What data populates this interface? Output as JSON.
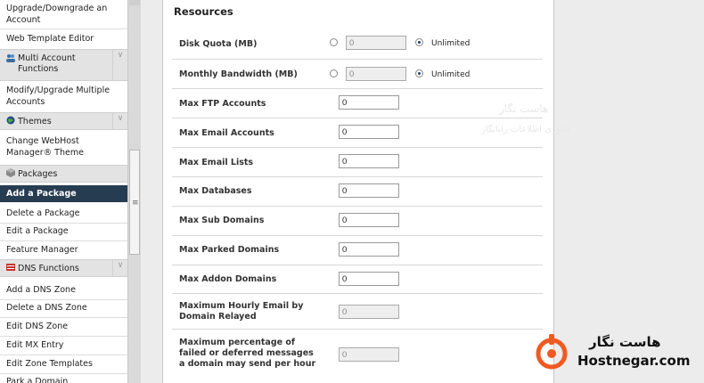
{
  "sidebar": {
    "top_item": "Upgrade/Downgrade an Account",
    "web_template": "Web Template Editor",
    "multi_account_header": "Multi Account Functions",
    "modify_upgrade": "Modify/Upgrade Multiple Accounts",
    "themes_header": "Themes",
    "change_theme": "Change WebHost Manager® Theme",
    "packages_header": "Packages",
    "add_package": "Add a Package",
    "delete_package": "Delete a Package",
    "edit_package": "Edit a Package",
    "feature_manager": "Feature Manager",
    "dns_header": "DNS Functions",
    "add_dns": "Add a DNS Zone",
    "delete_dns": "Delete a DNS Zone",
    "edit_dns": "Edit DNS Zone",
    "edit_mx": "Edit MX Entry",
    "edit_zone_templates": "Edit Zone Templates",
    "park_domain": "Park a Domain"
  },
  "resources": {
    "title": "Resources",
    "unlimited_label": "Unlimited",
    "disk_quota": {
      "label": "Disk Quota (MB)",
      "value": "0",
      "unlimited_selected": true
    },
    "monthly_bandwidth": {
      "label": "Monthly Bandwidth (MB)",
      "value": "0",
      "unlimited_selected": true
    },
    "fields": [
      {
        "label": "Max FTP Accounts",
        "value": "0"
      },
      {
        "label": "Max Email Accounts",
        "value": "0"
      },
      {
        "label": "Max Email Lists",
        "value": "0"
      },
      {
        "label": "Max Databases",
        "value": "0"
      },
      {
        "label": "Max Sub Domains",
        "value": "0"
      },
      {
        "label": "Max Parked Domains",
        "value": "0"
      },
      {
        "label": "Max Addon Domains",
        "value": "0"
      }
    ],
    "hourly_email": {
      "label_line1": "Maximum Hourly Email by",
      "label_line2": "Domain Relayed",
      "value": "0"
    },
    "failed_percentage": {
      "label_line1": "Maximum percentage of",
      "label_line2": "failed or deferred messages",
      "label_line3": "a domain may send per hour",
      "value": "0"
    }
  },
  "watermark": {
    "fa": "هاست نگار",
    "en": "Hostnegar.com",
    "tagline_fa": "فناوری اطلاعات رایانگار"
  },
  "colors": {
    "accent": "#263c51",
    "brand_orange": "#f05a22"
  }
}
